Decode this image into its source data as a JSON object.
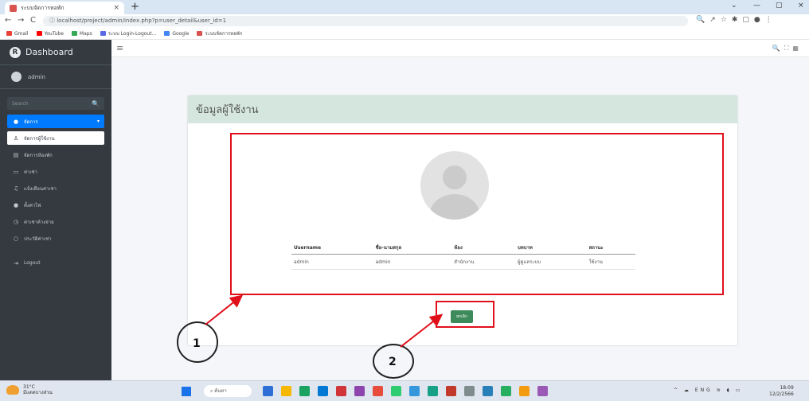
{
  "browser": {
    "tab_title": "ระบบจัดการหอพัก",
    "tab_close": "×",
    "new_tab": "+",
    "window_controls": [
      "⌄",
      "—",
      "▢",
      "×"
    ],
    "url": "localhost/project/admin/index.php?p=user_detail&user_id=1",
    "bookmarks": [
      {
        "label": "Gmail",
        "color": "#ea4335"
      },
      {
        "label": "YouTube",
        "color": "#ff0000"
      },
      {
        "label": "Maps",
        "color": "#34a853"
      },
      {
        "label": "ระบบ Login-Logout...",
        "color": "#5a6ae6"
      },
      {
        "label": "Google",
        "color": "#4285f4"
      },
      {
        "label": "ระบบจัดการหอพัก",
        "color": "#d9534f"
      }
    ]
  },
  "sidebar": {
    "brand": "Dashboard",
    "user": "admin",
    "search_placeholder": "Search",
    "items": [
      {
        "label": "จัดการ",
        "icon": "dashboard-icon"
      },
      {
        "label": "จัดการผู้ใช้งาน",
        "icon": "users-icon"
      },
      {
        "label": "จัดการห้องพัก",
        "icon": "room-icon"
      },
      {
        "label": "ค่าเช่า",
        "icon": "money-icon"
      },
      {
        "label": "แจ้งเตือนค่าเช่า",
        "icon": "bell-icon"
      },
      {
        "label": "ตั้งค่าไฟ",
        "icon": "settings-icon"
      },
      {
        "label": "ค่าเช่าค้างจ่าย",
        "icon": "clock-icon"
      },
      {
        "label": "ประวัติค่าเช่า",
        "icon": "history-icon"
      },
      {
        "label": "Logout",
        "icon": "logout-icon"
      }
    ]
  },
  "main": {
    "card_title": "ข้อมูลผู้ใช้งาน",
    "table": {
      "headers": [
        "Username",
        "ชื่อ-นามสกุล",
        "ห้อง",
        "บทบาท",
        "สถานะ"
      ],
      "rows": [
        [
          "admin",
          "admin",
          "สำนักงาน",
          "ผู้ดูแลระบบ",
          "ใช้งาน"
        ]
      ]
    },
    "back_button": "ยกเลิก"
  },
  "annotations": [
    "1",
    "2"
  ],
  "taskbar": {
    "temp": "31°C",
    "weather": "มีแดดบางส่วน",
    "search": "ค้นหา",
    "tray": "ENG",
    "time": "18:09",
    "date": "12/2/2566",
    "app_colors": [
      "#2f6fd6",
      "#f6b800",
      "#1aa260",
      "#0078d4",
      "#d13438",
      "#8e44ad",
      "#e74c3c",
      "#2ecc71",
      "#3498db",
      "#16a085",
      "#c0392b",
      "#7f8c8d",
      "#2980b9",
      "#27ae60",
      "#f39c12",
      "#9b59b6"
    ]
  }
}
